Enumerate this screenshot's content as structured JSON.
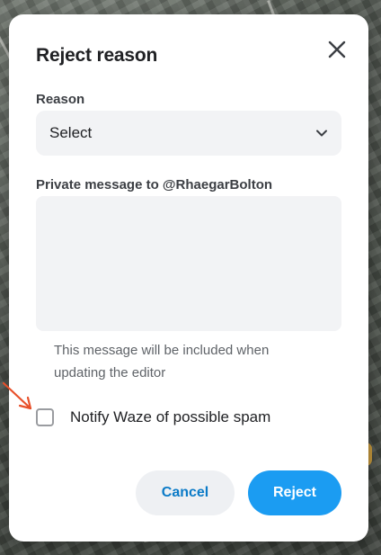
{
  "dialog": {
    "title": "Reject reason",
    "reason": {
      "label": "Reason",
      "value": "Select"
    },
    "message": {
      "label": "Private message to @RhaegarBolton",
      "value": "",
      "helper": "This message will be included when updating the editor"
    },
    "spam_checkbox": {
      "label": "Notify Waze of possible spam",
      "checked": false
    },
    "buttons": {
      "cancel": "Cancel",
      "reject": "Reject"
    }
  },
  "icons": {
    "close": "close-icon",
    "dropdown": "chevron-down-icon",
    "annotation": "red-arrow-icon"
  },
  "colors": {
    "primary": "#1b9cf2",
    "cancel_text": "#0a7ac7",
    "annotation_arrow": "#e8502a"
  }
}
